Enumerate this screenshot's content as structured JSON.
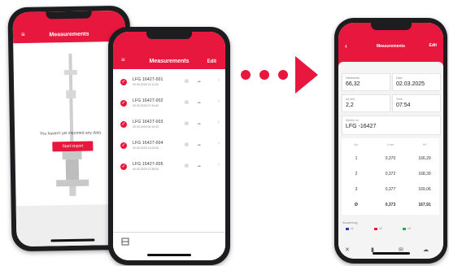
{
  "colors": {
    "accent": "#e8173e",
    "phone_frame": "#1d1d1f"
  },
  "phone1": {
    "title": "Measurements",
    "menu_icon": "hamburger-icon",
    "empty_message": "You haven't yet imported any data.",
    "start_import_label": "Start import"
  },
  "phone2": {
    "title": "Measurements",
    "edit_label": "Edit",
    "menu_icon": "hamburger-icon",
    "rows": [
      {
        "name": "LFG 16427-001",
        "date": "00.00.2025  10:11:00"
      },
      {
        "name": "LFG 16427-002",
        "date": "00.00.2025  07:34:00"
      },
      {
        "name": "LFG 16427-003",
        "date": "00.00.2025  00:10:00"
      },
      {
        "name": "LFG 16427-004",
        "date": "00.00.2025  12:02:00"
      },
      {
        "name": "LFG 16427-005",
        "date": "00.00.2025  12:35:00"
      }
    ],
    "bottom_icon": "export-icon"
  },
  "phone3": {
    "edit_label": "Edit",
    "title": "Measurements",
    "fields": {
      "hardness_label": "Härtewerte",
      "hardness_value": "66,32",
      "date_label": "Date",
      "date_value": "02.03.2025",
      "val2_label": "sd (rel)",
      "val2_value": "2,2",
      "time_label": "Time",
      "time_value": "07:54",
      "device_label": "Device no.",
      "device_value": "LFG -16427"
    },
    "table": {
      "headers": [
        "No.",
        "L mm",
        "HV"
      ],
      "rows": [
        [
          "1",
          "0,370",
          "166,29"
        ],
        [
          "2",
          "0,372",
          "168,39"
        ],
        [
          "3",
          "0,377",
          "169,06"
        ]
      ],
      "avg": [
        "Ø",
        "0,373",
        "167,91"
      ]
    },
    "legend_title": "Auswertung",
    "legend": [
      {
        "label": "x1",
        "color": "#2b3fb0"
      },
      {
        "label": "x2",
        "color": "#e8173e"
      },
      {
        "label": "x3",
        "color": "#2aa84a"
      }
    ]
  }
}
